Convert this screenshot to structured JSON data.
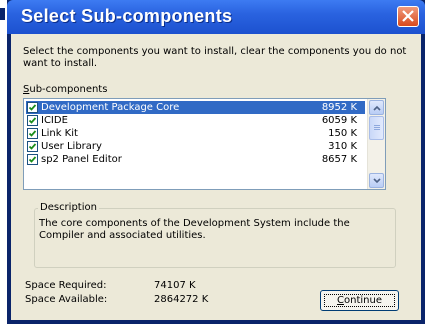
{
  "window": {
    "title": "Select Sub-components",
    "icons": {
      "close": "close-icon"
    }
  },
  "intro_text": "Select the components you want to install, clear the components you do not want to install.",
  "subcomponents": {
    "label_mnemonic": "S",
    "label_rest": "ub-components",
    "items": [
      {
        "name": "Development Package Core",
        "size": "8952 K",
        "checked": true,
        "selected": true
      },
      {
        "name": "ICIDE",
        "size": "6059 K",
        "checked": true,
        "selected": false
      },
      {
        "name": "Link Kit",
        "size": "150 K",
        "checked": true,
        "selected": false
      },
      {
        "name": "User Library",
        "size": "310 K",
        "checked": true,
        "selected": false
      },
      {
        "name": "sp2 Panel Editor",
        "size": "8657 K",
        "checked": true,
        "selected": false
      }
    ]
  },
  "description": {
    "legend": "Description",
    "text": "The core components of the Development System include the Compiler and associated utilities."
  },
  "space": {
    "required_label": "Space Required:",
    "required_value": "74107 K",
    "available_label": "Space Available:",
    "available_value": "2864272 K"
  },
  "continue_button": {
    "mnemonic": "C",
    "rest": "ontinue"
  },
  "colors": {
    "titlebar": "#2a63e0",
    "selection": "#316ac5",
    "dialog_bg": "#ece9d8",
    "close_button": "#d94a1e"
  }
}
